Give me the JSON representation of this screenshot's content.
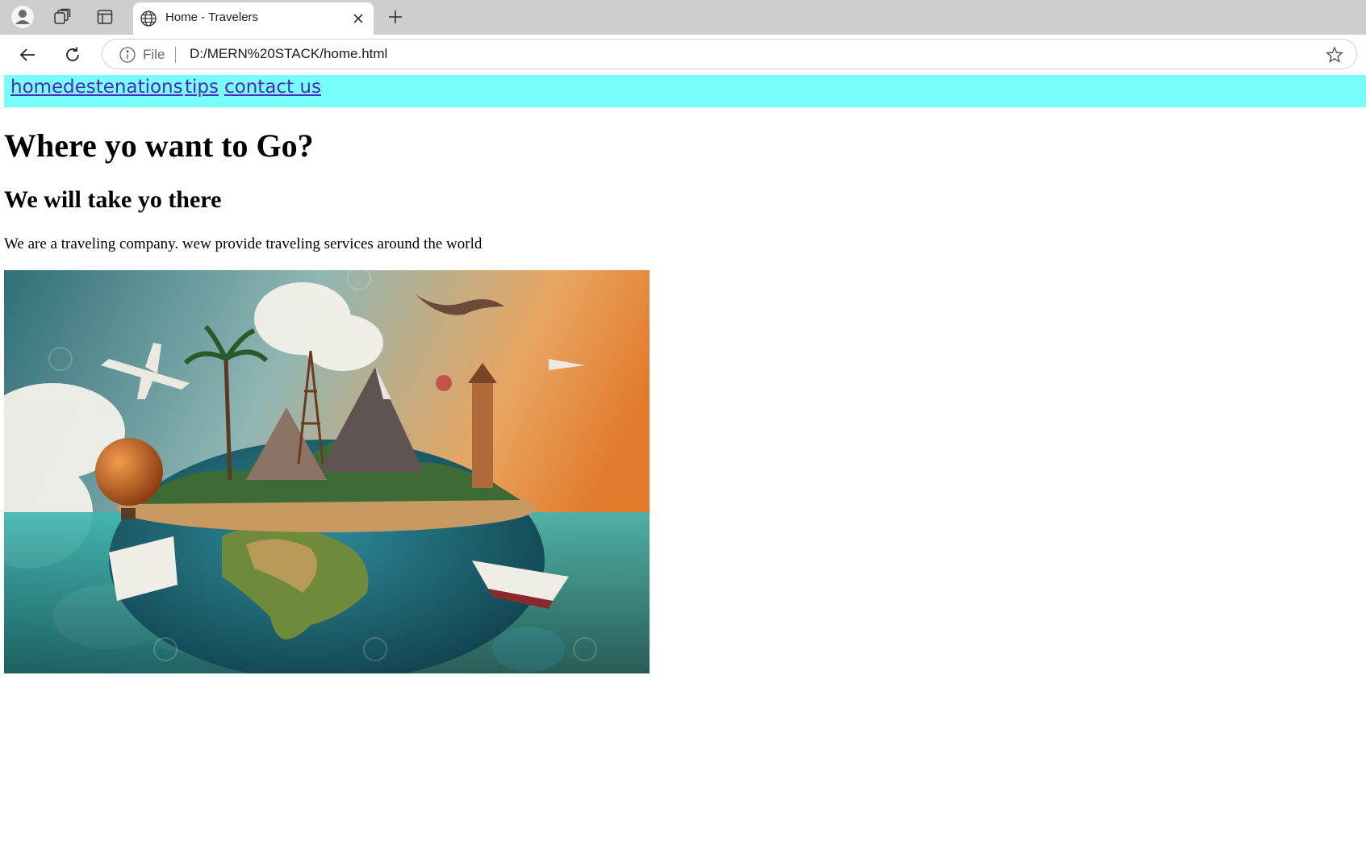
{
  "browser": {
    "tab_title": "Home - Travelers",
    "url_scheme": "File",
    "url": "D:/MERN%20STACK/home.html"
  },
  "icons": {
    "profile": "profile-icon",
    "workspaces": "workspaces-icon",
    "vertical_tabs": "vertical-tabs-icon",
    "globe": "globe-icon",
    "close": "close-icon",
    "new_tab": "plus-icon",
    "back": "back-arrow-icon",
    "reload": "reload-icon",
    "info": "info-icon",
    "favorite": "star-icon"
  },
  "colors": {
    "navbar_bg": "#79fcfc",
    "link": "#4a2db5"
  },
  "nav": {
    "links": [
      "home",
      "destenations",
      "tips",
      "contact us"
    ]
  },
  "page": {
    "heading": "Where yo want to Go?",
    "subheading": "We will take yo there",
    "description": "We are a traveling company. wew provide traveling services around the world"
  }
}
